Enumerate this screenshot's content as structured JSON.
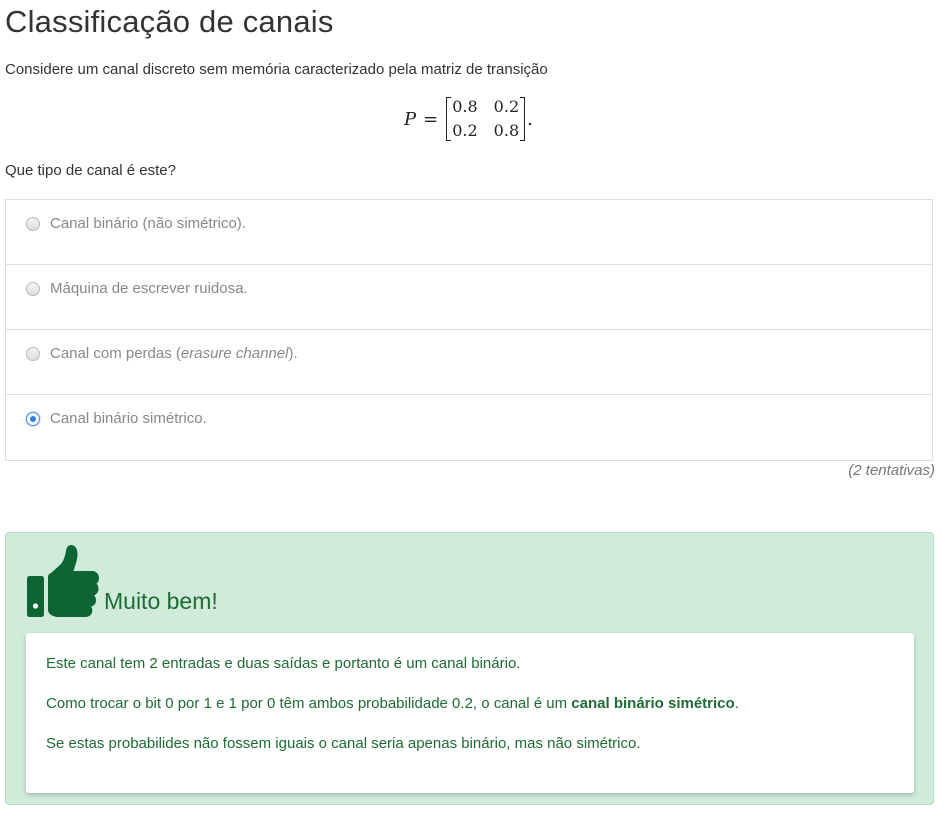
{
  "page": {
    "title": "Classificação de canais",
    "intro": "Considere um canal discreto sem memória caracterizado pela matriz de transição",
    "question": "Que tipo de canal é este?"
  },
  "matrix": {
    "variable": "P",
    "equals": "=",
    "rows": [
      [
        "0.8",
        "0.2"
      ],
      [
        "0.2",
        "0.8"
      ]
    ],
    "trailing": "."
  },
  "options": [
    {
      "label": "Canal binário (não simétrico).",
      "selected": false
    },
    {
      "label": "Máquina de escrever ruidosa.",
      "selected": false
    },
    {
      "label_prefix": "Canal com perdas (",
      "label_em": "erasure channel",
      "label_suffix": ").",
      "selected": false
    },
    {
      "label": "Canal binário simétrico.",
      "selected": true
    }
  ],
  "attempts": "(2 tentativas)",
  "feedback": {
    "icon": "thumbs-up-icon",
    "title": "Muito bem!",
    "p1": "Este canal tem 2 entradas e duas saídas e portanto é um canal binário.",
    "p2_prefix": "Como trocar o bit 0 por 1 e 1 por 0 têm ambos probabilidade 0.2, o canal é um ",
    "p2_bold": "canal binário simétrico",
    "p2_suffix": ".",
    "p3": "Se estas probabilides não fossem iguais o canal seria apenas binário, mas não simétrico."
  },
  "colors": {
    "feedback_bg": "#d0ebda",
    "feedback_text": "#1e6b34",
    "thumb": "#0d6536",
    "radio_selected": "#2f7fe0"
  }
}
